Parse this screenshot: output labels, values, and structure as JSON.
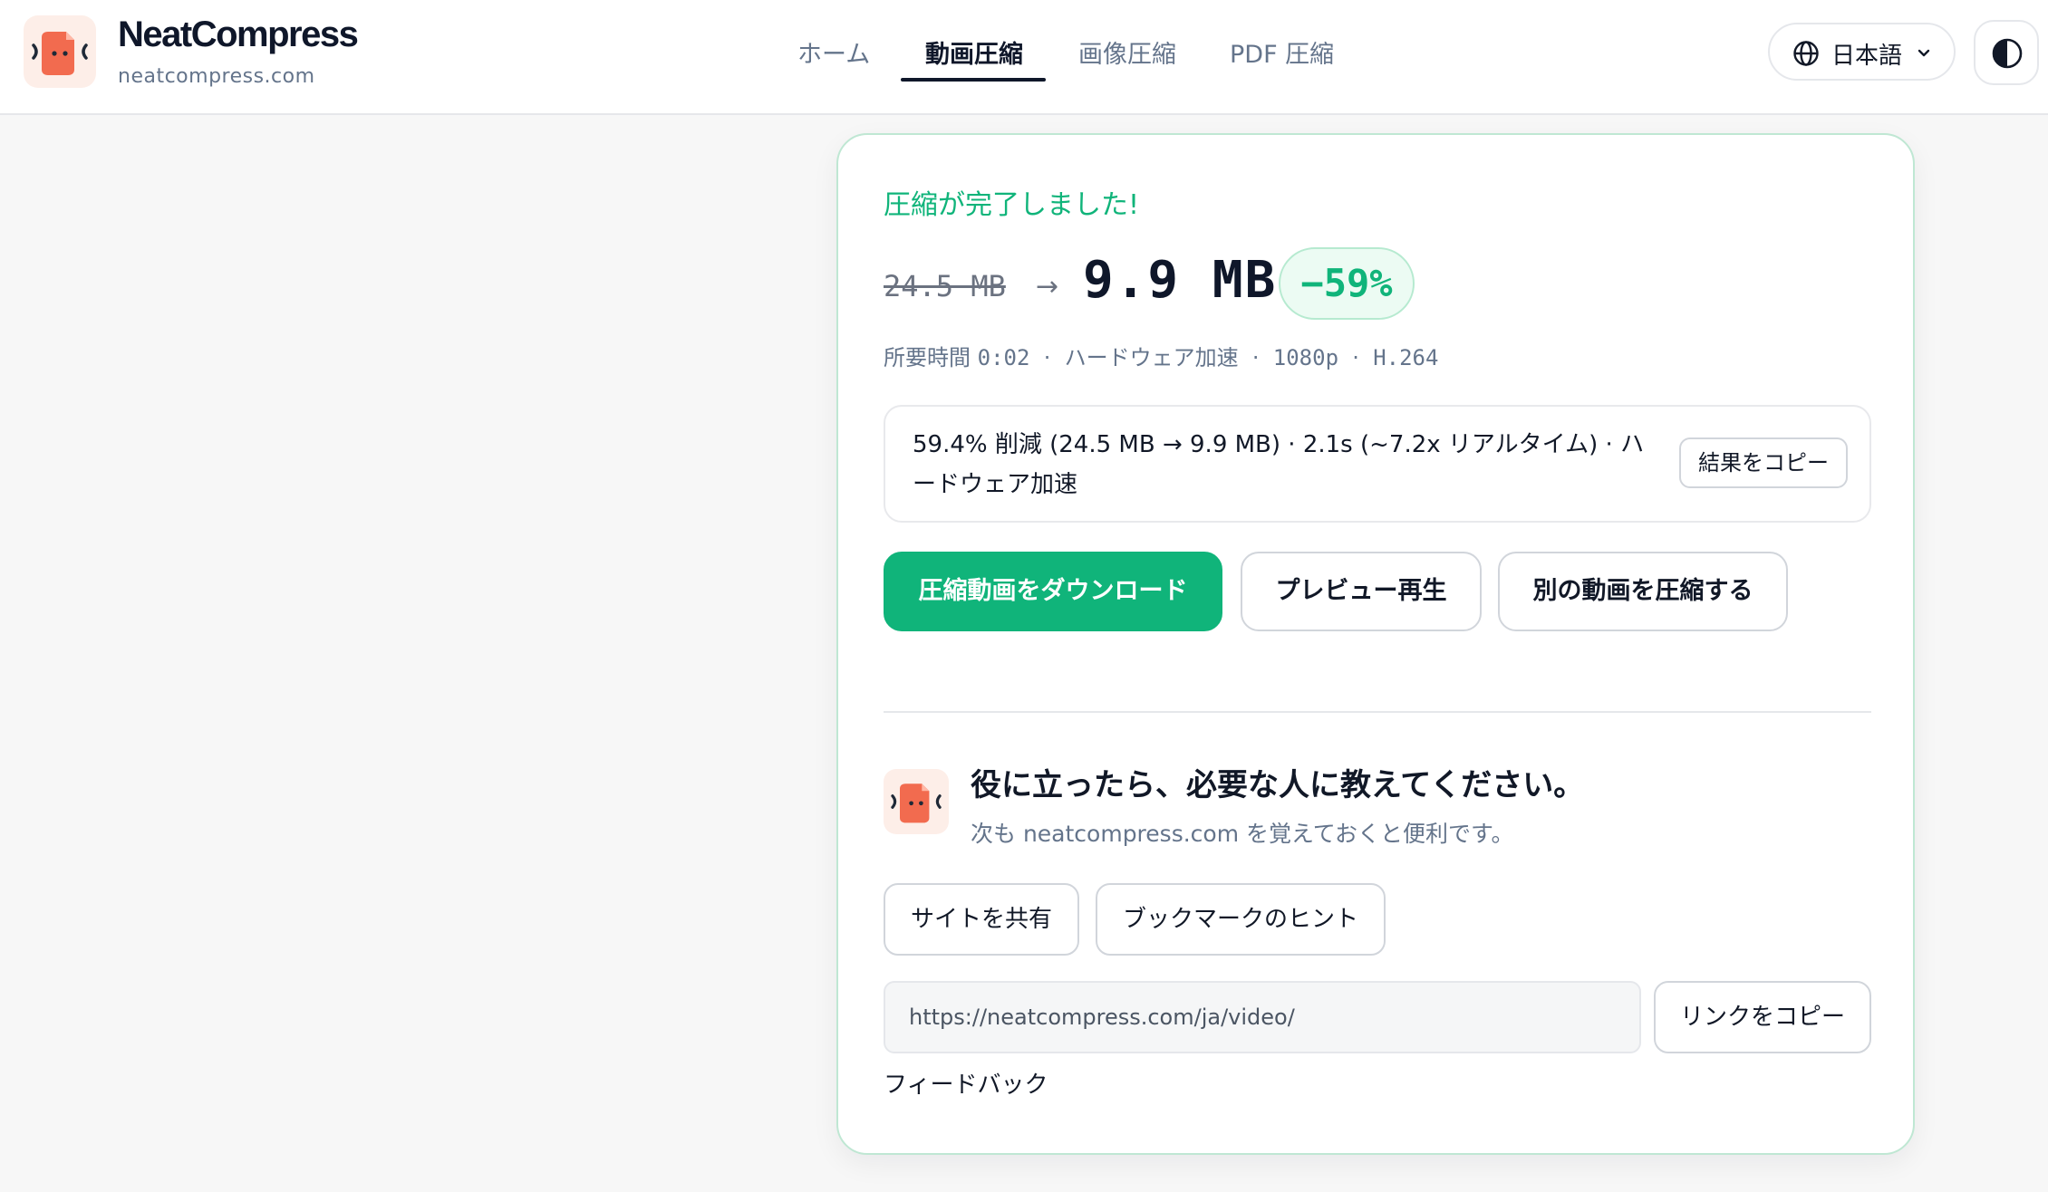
{
  "app": {
    "brand_name": "NeatCompress",
    "brand_domain": "neatcompress.com",
    "accent_color": "#10b47a",
    "logo_color": "#f26b4f"
  },
  "nav": {
    "items": [
      {
        "label": "ホーム",
        "active": false
      },
      {
        "label": "動画圧縮",
        "active": true
      },
      {
        "label": "画像圧縮",
        "active": false
      },
      {
        "label": "PDF 圧縮",
        "active": false
      }
    ]
  },
  "header": {
    "language_label": "日本語",
    "globe_icon": "globe-icon",
    "theme_icon": "contrast-icon"
  },
  "result": {
    "status": "圧縮が完了しました!",
    "original_size": "24.5 MB",
    "arrow": "→",
    "new_size": "9.9 MB",
    "reduction_badge": "−59%",
    "meta_label": "所要時間",
    "meta_time": "0:02",
    "meta_separator": "·",
    "meta_accel": "ハードウェア加速",
    "meta_resolution": "1080p",
    "meta_codec": "H.264",
    "summary": "59.4% 削減 (24.5 MB → 9.9 MB) · 2.1s (~7.2x リアルタイム) · ハードウェア加速",
    "copy_result_label": "結果をコピー"
  },
  "actions": {
    "download_label": "圧縮動画をダウンロード",
    "preview_label": "プレビュー再生",
    "another_label": "別の動画を圧縮する"
  },
  "share": {
    "title": "役に立ったら、必要な人に教えてください。",
    "subtitle": "次も neatcompress.com を覚えておくと便利です。",
    "share_site_label": "サイトを共有",
    "bookmark_hint_label": "ブックマークのヒント",
    "url_value": "https://neatcompress.com/ja/video/",
    "copy_link_label": "リンクをコピー",
    "feedback_label": "フィードバック"
  }
}
